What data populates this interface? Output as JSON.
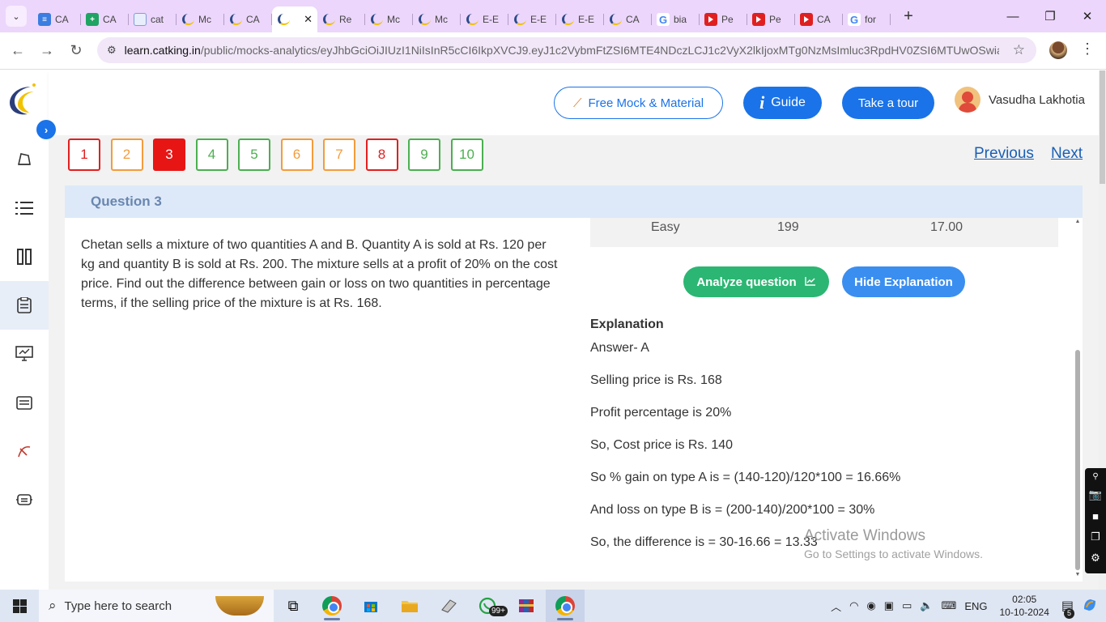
{
  "browser": {
    "tabs": [
      {
        "icon": "docs-icon",
        "title": "CA"
      },
      {
        "icon": "sheets-icon",
        "title": "CA"
      },
      {
        "icon": "page-icon",
        "title": "cat"
      },
      {
        "icon": "catking-icon",
        "title": "Mc"
      },
      {
        "icon": "catking-icon",
        "title": "CA"
      },
      {
        "icon": "catking-icon",
        "title": "",
        "active": true
      },
      {
        "icon": "catking-icon",
        "title": "Re"
      },
      {
        "icon": "catking-icon",
        "title": "Mc"
      },
      {
        "icon": "catking-icon",
        "title": "Mc"
      },
      {
        "icon": "catking-icon",
        "title": "E-E"
      },
      {
        "icon": "catking-icon",
        "title": "E-E"
      },
      {
        "icon": "catking-icon",
        "title": "E-E"
      },
      {
        "icon": "catking-icon",
        "title": "CA"
      },
      {
        "icon": "google-icon",
        "title": "bia"
      },
      {
        "icon": "youtube-icon",
        "title": "Pe"
      },
      {
        "icon": "youtube-icon",
        "title": "Pe"
      },
      {
        "icon": "youtube-icon",
        "title": "CA"
      },
      {
        "icon": "google-icon",
        "title": "for"
      }
    ],
    "url_domain": "learn.catking.in",
    "url_path": "/public/mocks-analytics/eyJhbGciOiJIUzI1NiIsInR5cCI6IkpXVCJ9.eyJ1c2VybmFtZSI6MTE4NDczLCJ1c2VyX2lkIjoxMTg0NzMsImluc3RpdHV0ZSI6MTUwOSwiaWQi..."
  },
  "header": {
    "free_mock_label": "Free Mock & Material",
    "guide_label": "Guide",
    "tour_label": "Take a tour",
    "user_name": "Vasudha Lakhotia"
  },
  "question_nav": {
    "numbers": [
      {
        "label": "1",
        "state": "red"
      },
      {
        "label": "2",
        "state": "orange"
      },
      {
        "label": "3",
        "state": "current"
      },
      {
        "label": "4",
        "state": "green"
      },
      {
        "label": "5",
        "state": "green"
      },
      {
        "label": "6",
        "state": "orange"
      },
      {
        "label": "7",
        "state": "orange"
      },
      {
        "label": "8",
        "state": "red"
      },
      {
        "label": "9",
        "state": "green"
      },
      {
        "label": "10",
        "state": "green"
      }
    ],
    "previous_label": "Previous",
    "next_label": "Next"
  },
  "question": {
    "title": "Question 3",
    "text": "Chetan sells a mixture of two quantities A and B. Quantity A is sold at Rs. 120 per kg and quantity B is sold at Rs. 200. The mixture sells at a profit of 20% on the cost price. Find out the difference between gain or loss on two quantities in percentage terms, if the selling price of the mixture is at Rs. 168.",
    "stats": {
      "difficulty": "Easy",
      "count": "199",
      "time": "17.00"
    },
    "analyze_label": "Analyze question",
    "hide_explanation_label": "Hide Explanation",
    "explanation_title": "Explanation",
    "explanation_lines": [
      "Answer- A",
      "Selling price is Rs. 168",
      "Profit percentage is 20%",
      "So, Cost price is Rs. 140",
      "So % gain on type A is = (140-120)/120*100 = 16.66%",
      "And loss on type B is = (200-140)/200*100 = 30%",
      "So, the difference is = 30-16.66 = 13.33"
    ]
  },
  "watermark": {
    "line1": "Activate Windows",
    "line2": "Go to Settings to activate Windows."
  },
  "taskbar": {
    "search_placeholder": "Type here to search",
    "whatsapp_badge": "99+",
    "language": "ENG",
    "time": "02:05",
    "date": "10-10-2024",
    "notification_count": "5"
  },
  "colors": {
    "accent_blue": "#1a73e8",
    "analyze_green": "#2bb673",
    "current_red": "#e81515",
    "tab_strip": "#ecd6fb"
  }
}
